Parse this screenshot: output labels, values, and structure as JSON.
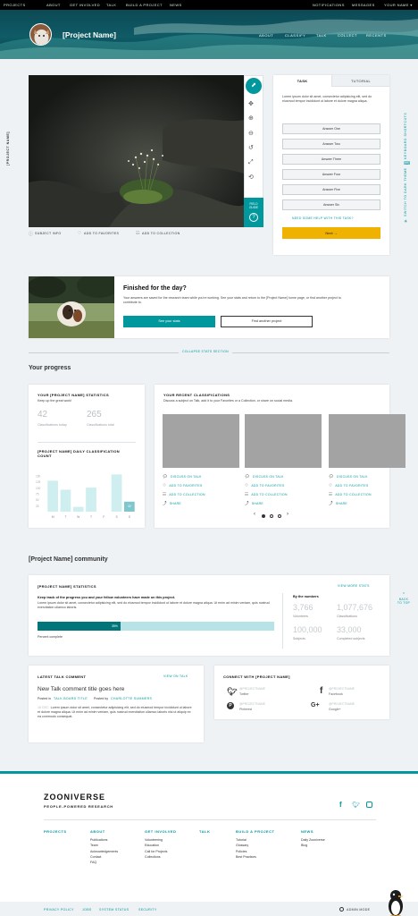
{
  "topnav": {
    "left": [
      "PROJECTS",
      "ABOUT",
      "GET INVOLVED",
      "TALK",
      "BUILD A PROJECT",
      "NEWS"
    ],
    "notifications": "NOTIFICATIONS",
    "messages": "MESSAGES",
    "user": "YOUR NAME ▾"
  },
  "project": {
    "name": "[Project Name]",
    "nav": [
      "ABOUT",
      "CLASSIFY",
      "TALK",
      "COLLECT",
      "RECENTS"
    ],
    "side_name": "[PROJECT NAME]"
  },
  "subject": {
    "field_guide": "FIELD GUIDE",
    "actions": [
      "SUBJECT INFO",
      "ADD TO FAVORITES",
      "ADD TO COLLECTION"
    ]
  },
  "task": {
    "tabs": [
      "TASK",
      "TUTORIAL"
    ],
    "text": "Lorem ipsum dolor sit amet, consectetur adipisicing elit, sed do eiusmod tempor incididunt ut labore et dolore magna aliqua.",
    "answers": [
      "Answer One",
      "Answer Two",
      "Answer Three",
      "Answer Four",
      "Answer Five",
      "Answer Six"
    ],
    "help": "NEED SOME HELP WITH THIS TASK?",
    "next": "Next →"
  },
  "right_side": {
    "shortcuts": "KEYBOARD SHORTCUTS",
    "dark": "SWITCH TO DARK THEME"
  },
  "finished": {
    "title": "Finished for the day?",
    "text": "Your answers are saved for the research team while you're working. See your stats and return to the [Project Name] home page, or find another project to contribute to.",
    "stats_btn": "See your stats",
    "another_btn": "Find another project"
  },
  "collapse": "COLLAPSE STATS SECTION",
  "progress": {
    "heading": "Your progress",
    "stats_title": "YOUR [PROJECT NAME] STATISTICS",
    "stats_sub": "Keep up the great work!",
    "today_value": "42",
    "today_label": "Classifications today",
    "total_value": "265",
    "total_label": "Classifications total",
    "daily_title": "[PROJECT NAME] DAILY CLASSIFICATION COUNT",
    "yticks": [
      "150",
      "125",
      "100",
      "75",
      "50",
      "25"
    ],
    "recent_title": "YOUR RECENT CLASSIFICATIONS",
    "recent_sub": "Discuss a subject on Talk, add it to your Favorites or a Collection, or share on social media.",
    "recent_actions": [
      "DISCUSS ON TALK",
      "ADD TO FAVORITES",
      "ADD TO COLLECTION",
      "SHARE"
    ]
  },
  "chart_data": {
    "type": "bar",
    "categories": [
      "M",
      "T",
      "W",
      "T",
      "F",
      "S",
      "S"
    ],
    "values": [
      130,
      92,
      20,
      101,
      0,
      156,
      42
    ],
    "data_labels": [
      "",
      "",
      "",
      "",
      "",
      "",
      "42"
    ],
    "title": "[PROJECT NAME] DAILY CLASSIFICATION COUNT",
    "ylim": [
      0,
      150
    ],
    "highlight_index": 6,
    "colors": {
      "bar": "#cfeef0",
      "highlight": "#7fc7cc"
    }
  },
  "community": {
    "heading": "[Project Name] community",
    "stats_title": "[PROJECT NAME] STATISTICS",
    "view_more": "VIEW MORE STATS",
    "lead": "Keep track of the progress you and your fellow volunteers have made on this project.",
    "text": "Lorem ipsum dolor sit amet, consectetur adipisicing elit, sed do eiusmod tempor incididunt ut labore et dolore magna aliqua. Ut enim ad minim veniam, quis nostrud exercitation ullamco laboris.",
    "percent": 35,
    "percent_label": "35%",
    "percent_caption": "Percent complete",
    "numbers_title": "By the numbers",
    "numbers": [
      {
        "value": "3,766",
        "label": "Volunteers"
      },
      {
        "value": "1,077,676",
        "label": "Classifications"
      },
      {
        "value": "100,000",
        "label": "Subjects"
      },
      {
        "value": "33,000",
        "label": "Completed subjects"
      }
    ]
  },
  "talk": {
    "title": "LATEST TALK COMMENT",
    "view": "VIEW ON TALK",
    "comment_title": "New Talk comment title goes here",
    "posted_in": "Posted in",
    "board": "TALK BOARD TITLE",
    "posted_by": "Posted by",
    "author": "CHARLOTTE SUMMERS",
    "date": "18 DEC",
    "body": "Lorem ipsum dolor sit amet, consectetur adipisicing elit, sed do eiusmod tempor incididunt ut labore et dolore magna aliqua. Ut enim ad minim veniam, quis nostrud exercitation ullamco laboris nisi ut aliquip ex ea commodo consequat."
  },
  "connect": {
    "title": "CONNECT WITH [PROJECT NAME]",
    "items": [
      {
        "handle": "@PROJECTNAME",
        "network": "Twitter"
      },
      {
        "handle": "@PROJECTNAME",
        "network": "Facebook"
      },
      {
        "handle": "@PROJECTNAME",
        "network": "Pinterest"
      },
      {
        "handle": "@PROJECTNAME",
        "network": "Google+"
      }
    ]
  },
  "back_to_top": "BACK TO TOP",
  "footer": {
    "logo": "ZOONIVERSE",
    "tagline": "PEOPLE-POWERED RESEARCH",
    "cols": [
      {
        "title": "PROJECTS",
        "items": []
      },
      {
        "title": "ABOUT",
        "items": [
          "Publications",
          "Team",
          "Acknowledgements",
          "Contact",
          "FAQ"
        ]
      },
      {
        "title": "GET INVOLVED",
        "items": [
          "Volunteering",
          "Education",
          "Call for Projects",
          "Collections"
        ]
      },
      {
        "title": "TALK",
        "items": []
      },
      {
        "title": "BUILD A PROJECT",
        "items": [
          "Tutorial",
          "Glossary",
          "Policies",
          "Best Practices"
        ]
      },
      {
        "title": "NEWS",
        "items": [
          "Daily Zooniverse",
          "Blog"
        ]
      }
    ],
    "bottom": [
      "PRIVACY POLICY",
      "JOBS",
      "SYSTEM STATUS",
      "SECURITY"
    ],
    "admin": "ADMIN MODE"
  }
}
